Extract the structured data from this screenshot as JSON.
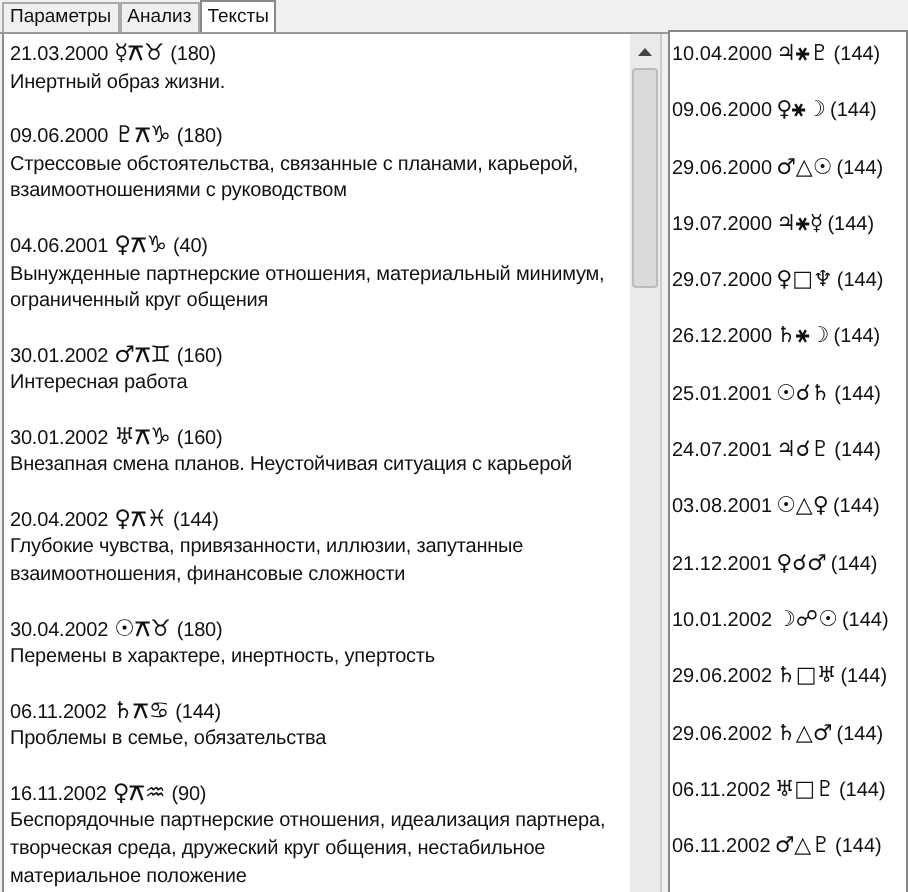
{
  "tabs": [
    {
      "label": "Параметры",
      "selected": false
    },
    {
      "label": "Анализ",
      "selected": false
    },
    {
      "label": "Тексты",
      "selected": true
    }
  ],
  "texts": [
    {
      "date": "21.03.2000",
      "aspect": "☿⚻♉",
      "orb": "(180)",
      "lines": [
        "Инертный образ жизни."
      ]
    },
    {
      "date": "09.06.2000",
      "aspect": "♇⚻♑",
      "orb": "(180)",
      "lines": [
        "Стрессовые обстоятельства, связанные с планами, карьерой,",
        "взаимоотношениями с руководством"
      ]
    },
    {
      "date": "04.06.2001",
      "aspect": "♀⚻♑",
      "orb": "(40)",
      "lines": [
        "Вынужденные партнерские отношения, материальный минимум,",
        "ограниченный круг общения"
      ]
    },
    {
      "date": "30.01.2002",
      "aspect": "♂⚻♊",
      "orb": "(160)",
      "lines": [
        "Интересная работа"
      ]
    },
    {
      "date": "30.01.2002",
      "aspect": "♅⚻♑",
      "orb": "(160)",
      "lines": [
        "Внезапная смена планов. Неустойчивая ситуация с карьерой"
      ]
    },
    {
      "date": "20.04.2002",
      "aspect": "♀⚻♓",
      "orb": "(144)",
      "lines": [
        "Глубокие чувства, привязанности, иллюзии, запутанные",
        "взаимоотношения, финансовые сложности"
      ]
    },
    {
      "date": "30.04.2002",
      "aspect": "☉⚻♉",
      "orb": "(180)",
      "lines": [
        "Перемены в характере, инертность, упертость"
      ]
    },
    {
      "date": "06.11.2002",
      "aspect": "♄⚻♋",
      "orb": "(144)",
      "lines": [
        "Проблемы в семье, обязательства"
      ]
    },
    {
      "date": "16.11.2002",
      "aspect": "♀⚻♒",
      "orb": "(90)",
      "lines": [
        "Беспорядочные партнерские отношения, идеализация партнера,",
        "творческая среда, дружеский круг общения, нестабильное",
        "материальное положение"
      ]
    }
  ],
  "aspects": [
    {
      "date": "10.04.2000",
      "aspect": "♃⚹♇",
      "orb": "(144)"
    },
    {
      "date": "09.06.2000",
      "aspect": "♀⚹☽",
      "orb": "(144)"
    },
    {
      "date": "29.06.2000",
      "aspect": "♂△☉",
      "orb": "(144)"
    },
    {
      "date": "19.07.2000",
      "aspect": "♃⚹☿",
      "orb": "(144)"
    },
    {
      "date": "29.07.2000",
      "aspect": "♀□♆",
      "orb": "(144)"
    },
    {
      "date": "26.12.2000",
      "aspect": "♄⚹☽",
      "orb": "(144)"
    },
    {
      "date": "25.01.2001",
      "aspect": "☉☌♄",
      "orb": "(144)"
    },
    {
      "date": "24.07.2001",
      "aspect": "♃☌♇",
      "orb": "(144)"
    },
    {
      "date": "03.08.2001",
      "aspect": "☉△♀",
      "orb": "(144)"
    },
    {
      "date": "21.12.2001",
      "aspect": "♀☌♂",
      "orb": "(144)"
    },
    {
      "date": "10.01.2002",
      "aspect": "☽☍☉",
      "orb": "(144)"
    },
    {
      "date": "29.06.2002",
      "aspect": "♄□♅",
      "orb": "(144)"
    },
    {
      "date": "29.06.2002",
      "aspect": "♄△♂",
      "orb": "(144)"
    },
    {
      "date": "06.11.2002",
      "aspect": "♅□♇",
      "orb": "(144)"
    },
    {
      "date": "06.11.2002",
      "aspect": "♂△♇",
      "orb": "(144)"
    }
  ]
}
